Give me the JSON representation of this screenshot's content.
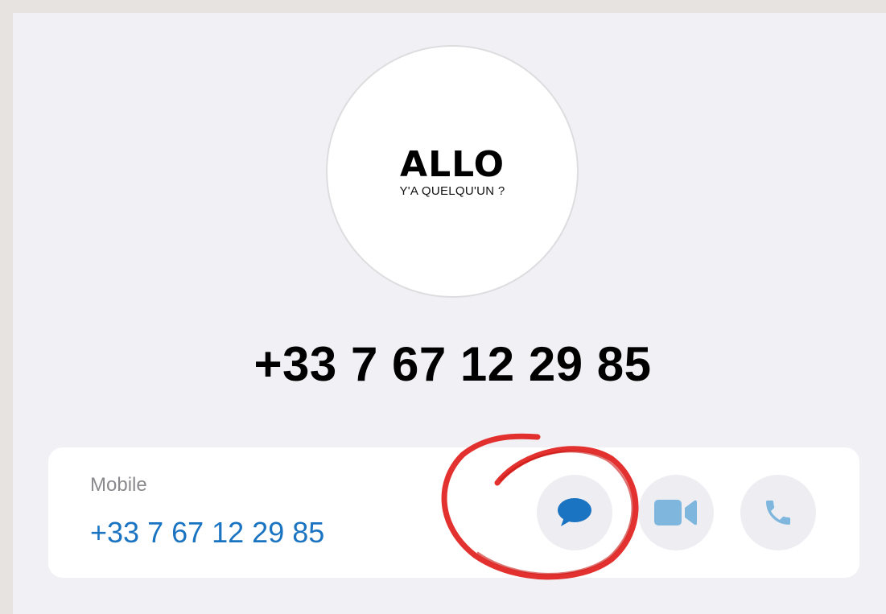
{
  "avatar": {
    "logo_text": "ALLO",
    "logo_subtext": "Y'A QUELQU'UN ?"
  },
  "contact": {
    "name": "+33 7 67 12 29 85"
  },
  "phone_card": {
    "label": "Mobile",
    "number": "+33 7 67 12 29 85",
    "actions": [
      {
        "name": "message",
        "icon": "message-bubble-icon",
        "color": "#1b74c1"
      },
      {
        "name": "video",
        "icon": "video-camera-icon",
        "color": "#7fb6de"
      },
      {
        "name": "call",
        "icon": "phone-icon",
        "color": "#7fb6de"
      }
    ]
  },
  "colors": {
    "accent": "#1b74c1",
    "accent_muted": "#7fb6de",
    "annotation": "#e0201c",
    "background": "#f1f1f5"
  }
}
